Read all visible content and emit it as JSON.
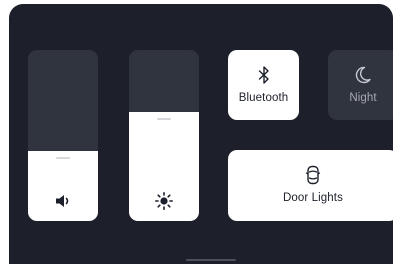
{
  "controls": {
    "volume": {
      "level": 0.41,
      "icon": "speaker-icon"
    },
    "brightness": {
      "level": 0.64,
      "icon": "sun-icon"
    },
    "bluetooth": {
      "label": "Bluetooth",
      "icon": "bluetooth-icon",
      "active": true
    },
    "night": {
      "label": "Night",
      "icon": "moon-icon",
      "active": false
    },
    "door_lights": {
      "label": "Door Lights",
      "icon": "car-door-icon",
      "active": true
    }
  },
  "colors": {
    "background": "#1d202b",
    "tile_inactive": "#30343f",
    "tile_active": "#ffffff",
    "label_active": "#1d202b",
    "label_inactive": "#a6a9b2"
  }
}
